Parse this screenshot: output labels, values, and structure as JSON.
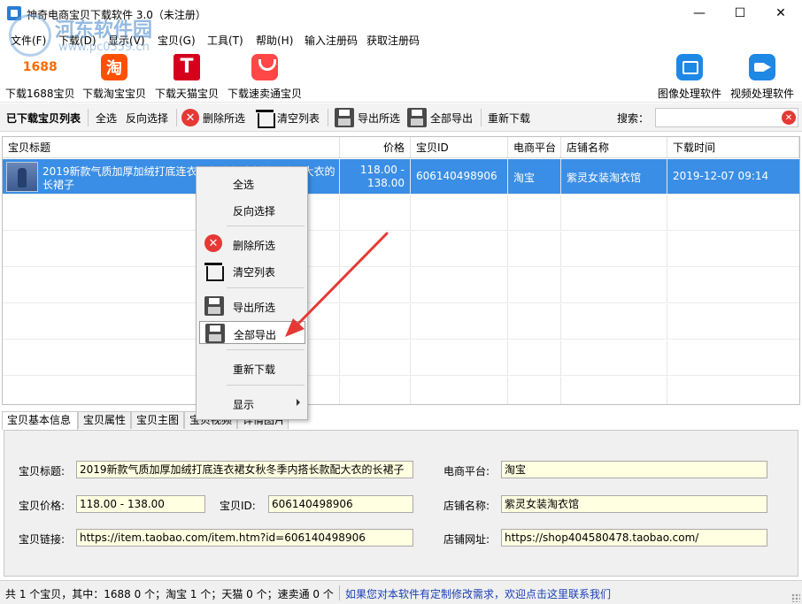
{
  "window": {
    "title": "神奇电商宝贝下载软件 3.0（未注册）",
    "minimize_icon": "minimize-icon",
    "maximize_icon": "maximize-icon",
    "close_icon": "close-icon"
  },
  "watermark": {
    "text": "河东软件园",
    "url": "www.pc0359.cn"
  },
  "menu": {
    "items": [
      "文件(F)",
      "下载(D)",
      "显示(V)",
      "宝贝(G)",
      "工具(T)",
      "帮助(H)",
      "输入注册码",
      "获取注册码"
    ]
  },
  "toolbar": {
    "download_1688": {
      "label": "下载1688宝贝",
      "icon_text": "1688"
    },
    "download_taobao": {
      "label": "下载淘宝宝贝",
      "icon_text": "淘"
    },
    "download_tmall": {
      "label": "下载天猫宝贝",
      "icon_text": "T"
    },
    "download_aliexpress": {
      "label": "下载速卖通宝贝"
    },
    "image_tool": {
      "label": "图像处理软件"
    },
    "video_tool": {
      "label": "视频处理软件"
    }
  },
  "list_toolbar": {
    "heading": "已下载宝贝列表",
    "select_all": "全选",
    "invert_select": "反向选择",
    "delete_selected": "删除所选",
    "clear_list": "清空列表",
    "export_selected": "导出所选",
    "export_all": "全部导出",
    "redownload": "重新下载",
    "search_label": "搜索：",
    "search_value": ""
  },
  "table": {
    "columns": [
      "宝贝标题",
      "价格",
      "宝贝ID",
      "电商平台",
      "店铺名称",
      "下载时间"
    ],
    "rows": [
      {
        "title": "2019新款气质加厚加绒打底连衣裙女秋冬季内搭长款配大衣的长裙子",
        "title_line1": "2019新款气质加厚加绒打底连衣裙女秋冬季内搭长款配大衣的",
        "title_line2": "长裙子",
        "price_line1": "118.00 -",
        "price_line2": "138.00",
        "id": "606140498906",
        "platform": "淘宝",
        "shop": "紫灵女装淘衣馆",
        "time": "2019-12-07 09:14",
        "selected": true
      }
    ]
  },
  "context_menu": {
    "items": [
      "全选",
      "反向选择",
      "删除所选",
      "清空列表",
      "导出所选",
      "全部导出",
      "重新下载",
      "显示"
    ],
    "highlighted": "全部导出"
  },
  "detail_tabs": [
    "宝贝基本信息",
    "宝贝属性",
    "宝贝主图",
    "宝贝视频",
    "详情图片"
  ],
  "detail": {
    "title_label": "宝贝标题:",
    "title_value": "2019新款气质加厚加绒打底连衣裙女秋冬季内搭长款配大衣的长裙子",
    "platform_label": "电商平台:",
    "platform_value": "淘宝",
    "price_label": "宝贝价格:",
    "price_value": "118.00 - 138.00",
    "id_label": "宝贝ID:",
    "id_value": "606140498906",
    "shop_label": "店铺名称:",
    "shop_value": "紫灵女装淘衣馆",
    "link_label": "宝贝链接:",
    "link_value": "https://item.taobao.com/item.htm?id=606140498906",
    "shop_url_label": "店铺网址:",
    "shop_url_value": "https://shop404580478.taobao.com/"
  },
  "status": {
    "summary": "共 1 个宝贝，其中：1688 0 个；淘宝 1 个；天猫 0 个；速卖通 0 个",
    "link": "如果您对本软件有定制修改需求，欢迎点击这里联系我们"
  },
  "colors": {
    "selection": "#3b8ee5",
    "field_bg": "#ffffe1",
    "status_link": "#1a3fb4",
    "annotation_arrow": "#e53935"
  }
}
